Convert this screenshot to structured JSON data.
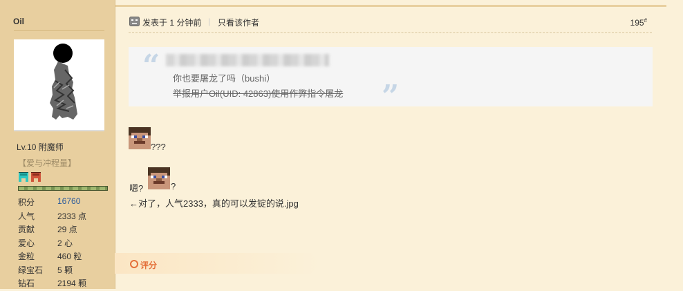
{
  "sidebar": {
    "username": "Oil",
    "level": "Lv.10 附魔师",
    "usergroup": "【爱与冲程量】",
    "stats": [
      {
        "label": "积分",
        "value": "16760",
        "highlight": true
      },
      {
        "label": "人气",
        "value": "2333 点"
      },
      {
        "label": "贡献",
        "value": "29 点"
      },
      {
        "label": "爱心",
        "value": "2 心"
      },
      {
        "label": "金粒",
        "value": "460 粒"
      },
      {
        "label": "绿宝石",
        "value": "5 颗"
      },
      {
        "label": "钻石",
        "value": "2194 颗"
      }
    ]
  },
  "post": {
    "posted_time": "发表于 1 分钟前",
    "separator": "|",
    "author_only": "只看该作者",
    "floor": "195",
    "floor_sup": "#",
    "quote": {
      "open_mark": "“",
      "close_mark": "”",
      "line1": "你也要屠龙了吗（bushi）",
      "line2": "举报用户Oil(UID: 42863)使用作弊指令屠龙"
    },
    "body": {
      "line1": "???",
      "line2_prefix": "嗯?",
      "line2_suffix": "?",
      "line3": "←对了，人气2333，真的可以发锭的说.jpg"
    }
  },
  "footer": {
    "rate_label": "评分"
  }
}
